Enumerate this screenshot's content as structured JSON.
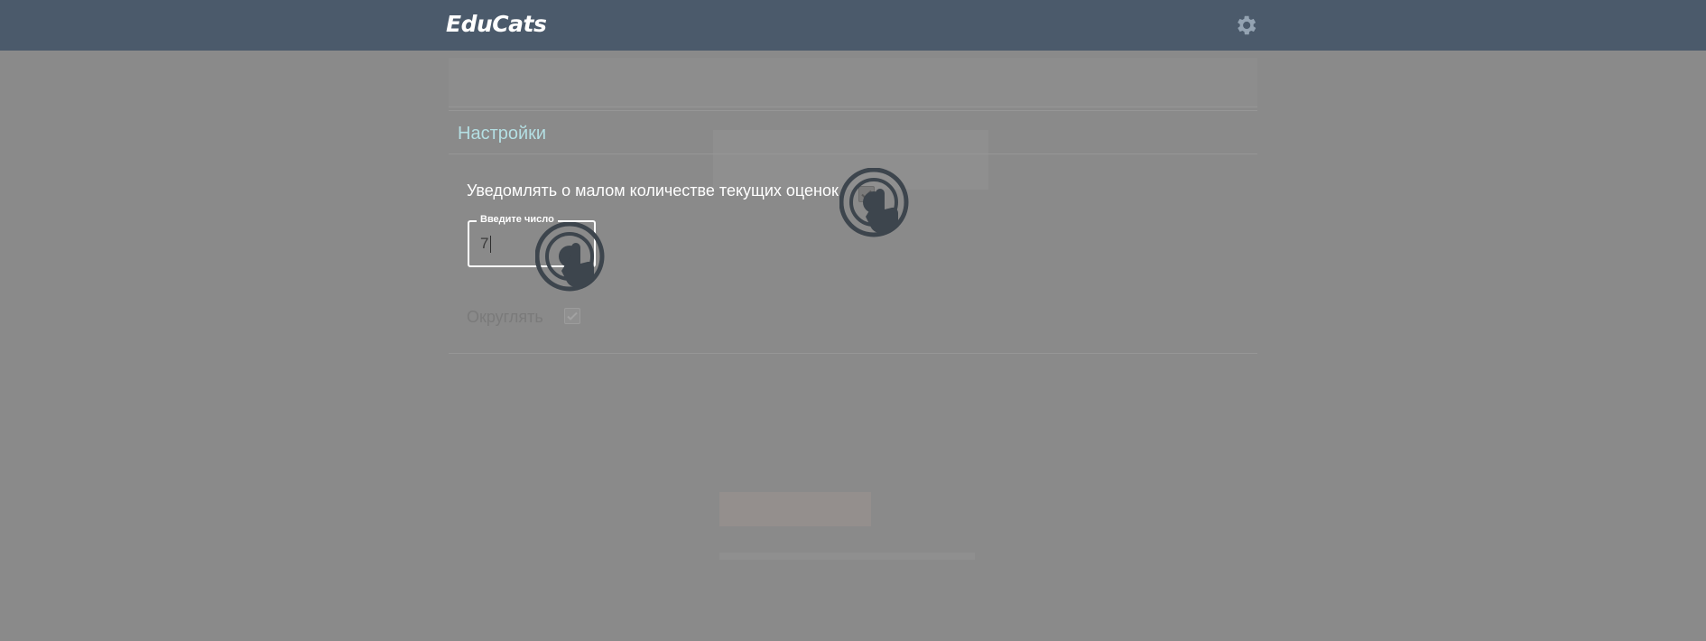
{
  "header": {
    "logo_text": "EduCats",
    "settings_icon": "gear-icon"
  },
  "settings": {
    "title": "Настройки",
    "notify_label": "Уведомлять о малом количестве текущих оценок",
    "notify_checked": true,
    "number_field": {
      "legend": "Введите число",
      "value": "7"
    },
    "round_label": "Округлять",
    "round_checked": true
  },
  "colors": {
    "header_bg": "#4b5a6b",
    "overlay_bg": "#8a8a8a",
    "title_accent": "#b4dfe3"
  },
  "hints": {
    "icon": "tap-hand-icon"
  }
}
